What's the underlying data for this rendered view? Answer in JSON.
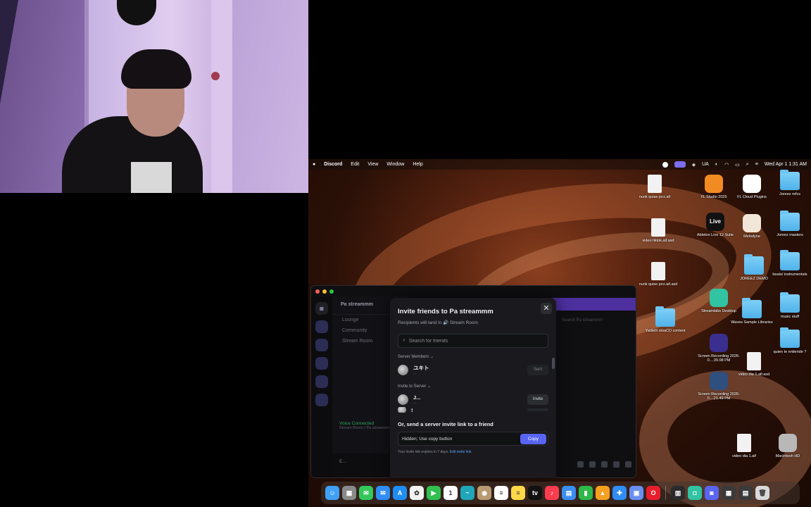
{
  "menubar": {
    "app": "Discord",
    "menus": [
      "Edit",
      "View",
      "Window",
      "Help"
    ],
    "input_source": "UA",
    "clock": "Wed Apr 1  1:31 AM"
  },
  "desktop_icons": [
    {
      "label": "nunk quise jorz.aif",
      "kind": "file"
    },
    {
      "label": "FL Studio 2025",
      "kind": "app",
      "color": "#f28c22"
    },
    {
      "label": "FL Cloud Plugins",
      "kind": "app",
      "color": "#ffffff"
    },
    {
      "label": "Joreez refcs",
      "kind": "folder"
    },
    {
      "label": "video tiktok.aif.asd",
      "kind": "file"
    },
    {
      "label": "Ableton Live 12 Suite",
      "kind": "app",
      "color": "#111111",
      "glyph": "Live"
    },
    {
      "label": "Melodyne",
      "kind": "app",
      "color": "#f2e6d8"
    },
    {
      "label": "Joreez masters",
      "kind": "folder"
    },
    {
      "label": "nunk quise jorz.aif.asd",
      "kind": "file"
    },
    {
      "label": "JOREEZ DEMO",
      "kind": "folder"
    },
    {
      "label": "beats/ instrumentals",
      "kind": "folder"
    },
    {
      "label": "Yadielit stoaCD content",
      "kind": "folder"
    },
    {
      "label": "Streamlabs Desktop",
      "kind": "app",
      "color": "#31c3a2"
    },
    {
      "label": "Waves Sample Libraries",
      "kind": "folder"
    },
    {
      "label": "music stuff",
      "kind": "folder"
    },
    {
      "label": "quien te entiende ?",
      "kind": "folder"
    },
    {
      "label": "Screen Recording 2026-0....39.08 PM",
      "kind": "app",
      "color": "#3a2e8e"
    },
    {
      "label": "video dia 1.aif.asd",
      "kind": "file"
    },
    {
      "label": "Screen Recording 2026-0....21.49 PM",
      "kind": "app",
      "color": "#2f4f7e"
    },
    {
      "label": "video dia 1.aif",
      "kind": "file"
    },
    {
      "label": "Macintosh HD",
      "kind": "app",
      "color": "#b8b8b8"
    }
  ],
  "discord": {
    "server_name": "Pa streammm",
    "channels": [
      "Lounge",
      "Community",
      "Stream Room"
    ],
    "voice_status": "Voice Connected",
    "voice_sub": "Stream Room / Pa streammm",
    "search_label": "Search Pa streammm",
    "user_short": "E..."
  },
  "invite": {
    "title": "Invite friends to Pa streammm",
    "subtitle": "Recipients will land in 🔊 Stream Room",
    "search_placeholder": "Search for friends",
    "section_members": "Server Members ⌄",
    "member_name": "ユキト",
    "member_sub": "...",
    "member_button": "Sent",
    "section_invite": "Invite to Server ⌄",
    "invite_name": "J...",
    "invite_sub": "...",
    "invite_button": "Invite",
    "partial_name": "!",
    "link_heading": "Or, send a server invite link to a friend",
    "link_value": "Hidden; Use copy button",
    "copy_label": "Copy",
    "footnote": "Your invite link expires in 7 days.",
    "footnote_link": "Edit invite link."
  },
  "dock": {
    "icons": [
      {
        "name": "finder",
        "color": "#3fa0f5",
        "glyph": "☺"
      },
      {
        "name": "launchpad",
        "color": "#8a8a8a",
        "glyph": "▦"
      },
      {
        "name": "messages",
        "color": "#34c759",
        "glyph": "✉"
      },
      {
        "name": "mail",
        "color": "#2f8df5",
        "glyph": "✉"
      },
      {
        "name": "appstore",
        "color": "#1e8ef5",
        "glyph": "A"
      },
      {
        "name": "photos",
        "color": "#f2f2f2",
        "glyph": "✿"
      },
      {
        "name": "facetime",
        "color": "#30c050",
        "glyph": "▶"
      },
      {
        "name": "calendar",
        "color": "#ffffff",
        "glyph": "1"
      },
      {
        "name": "freeform",
        "color": "#1fa6b8",
        "glyph": "~"
      },
      {
        "name": "contacts",
        "color": "#b89a70",
        "glyph": "◉"
      },
      {
        "name": "reminders",
        "color": "#ffffff",
        "glyph": "≡"
      },
      {
        "name": "notes",
        "color": "#ffd84a",
        "glyph": "≡"
      },
      {
        "name": "appletv",
        "color": "#111111",
        "glyph": "tv"
      },
      {
        "name": "music",
        "color": "#fa3c4e",
        "glyph": "♪"
      },
      {
        "name": "files",
        "color": "#3a8ef5",
        "glyph": "▤"
      },
      {
        "name": "numbers",
        "color": "#2fb84a",
        "glyph": "▮"
      },
      {
        "name": "keynote",
        "color": "#f5a020",
        "glyph": "▲"
      },
      {
        "name": "xcode",
        "color": "#2f8df5",
        "glyph": "✚"
      },
      {
        "name": "preview",
        "color": "#6a8ff0",
        "glyph": "▣"
      },
      {
        "name": "opera",
        "color": "#e81e2c",
        "glyph": "O"
      },
      {
        "name": "audio-mixer",
        "color": "#2b2b2b",
        "glyph": "▥"
      },
      {
        "name": "streamlabs",
        "color": "#31c3a2",
        "glyph": "◘"
      },
      {
        "name": "discord",
        "color": "#5865f2",
        "glyph": "◙"
      },
      {
        "name": "downloads",
        "color": "#3a3a3a",
        "glyph": "▦"
      },
      {
        "name": "documents",
        "color": "#3a3a3a",
        "glyph": "▤"
      },
      {
        "name": "trash",
        "color": "#d8d8d8",
        "glyph": "🗑"
      }
    ]
  }
}
